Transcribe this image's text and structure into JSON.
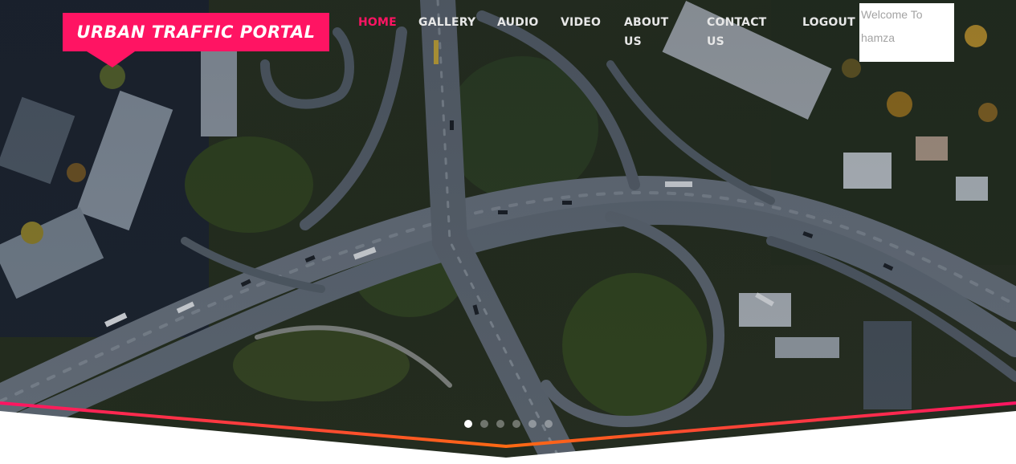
{
  "brand": {
    "title": "URBAN TRAFFIC PORTAL",
    "badge_color": "#ff1463"
  },
  "nav": {
    "items": [
      {
        "label": "HOME",
        "active": true
      },
      {
        "label": "GALLERY",
        "active": false
      },
      {
        "label": "AUDIO",
        "active": false
      },
      {
        "label": "VIDEO",
        "active": false
      },
      {
        "label": "ABOUT",
        "label2": "US",
        "active": false
      },
      {
        "label": "CONTACT",
        "label2": "US",
        "active": false
      },
      {
        "label": "LOGOUT",
        "active": false
      }
    ],
    "active_color": "#ff1463"
  },
  "welcome": {
    "line1": "Welcome To",
    "line2": "hamza"
  },
  "slider": {
    "slide_count": 6,
    "active_slide": 1,
    "image_icon": "aerial-highway-interchange-image"
  },
  "divider": {
    "gradient_colors": [
      "#ff1463",
      "#ff6a13"
    ]
  }
}
